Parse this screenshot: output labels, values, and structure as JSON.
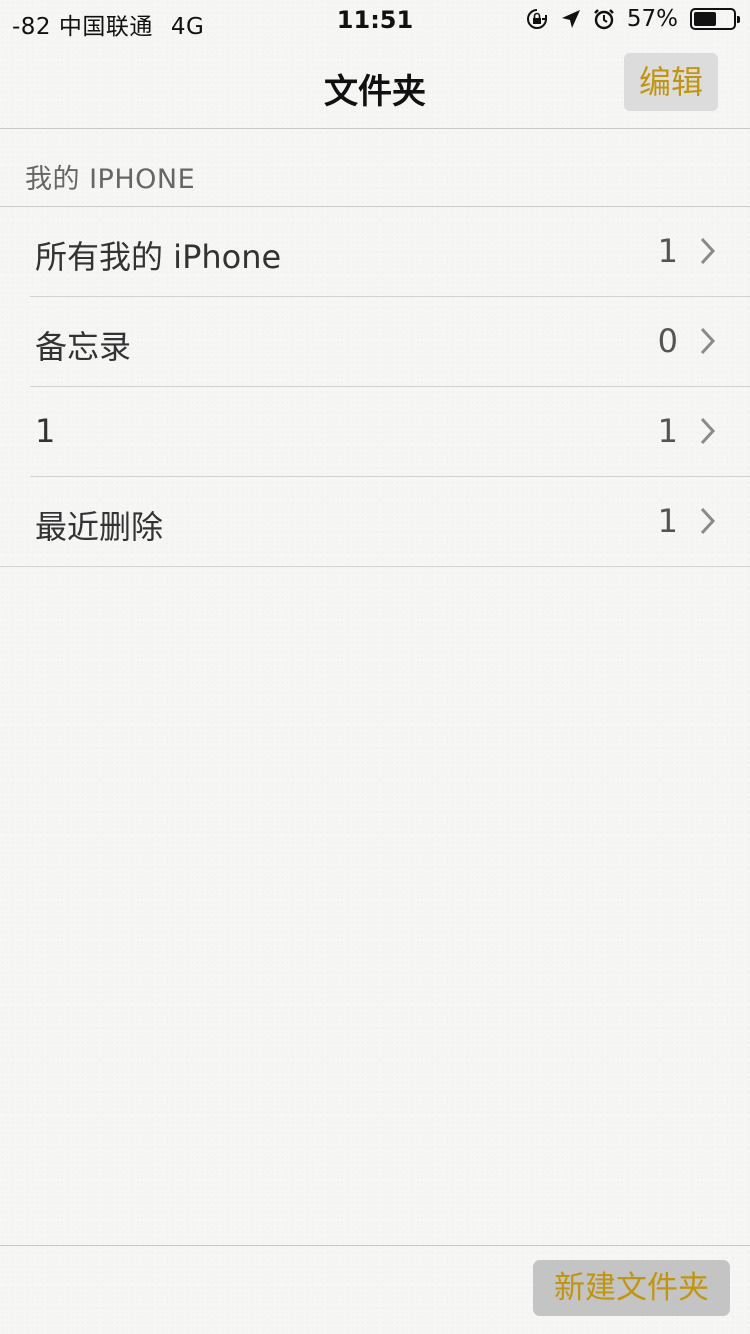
{
  "status_bar": {
    "carrier": "-82 中国联通",
    "network": "4G",
    "time": "11:51",
    "battery_percent_text": "57%",
    "battery_level": 0.57,
    "icons": [
      "orientation-lock-icon",
      "location-arrow-icon",
      "alarm-icon",
      "battery-icon"
    ]
  },
  "nav": {
    "title": "文件夹",
    "edit_label": "编辑"
  },
  "section": {
    "header": "我的 IPHONE"
  },
  "folders": [
    {
      "name": "所有我的 iPhone",
      "count": "1"
    },
    {
      "name": "备忘录",
      "count": "0"
    },
    {
      "name": "1",
      "count": "1"
    },
    {
      "name": "最近删除",
      "count": "1"
    }
  ],
  "toolbar": {
    "new_folder_label": "新建文件夹"
  },
  "colors": {
    "accent": "#c29510",
    "background": "#f6f6f5",
    "button_bg": "#dcdcdc"
  }
}
